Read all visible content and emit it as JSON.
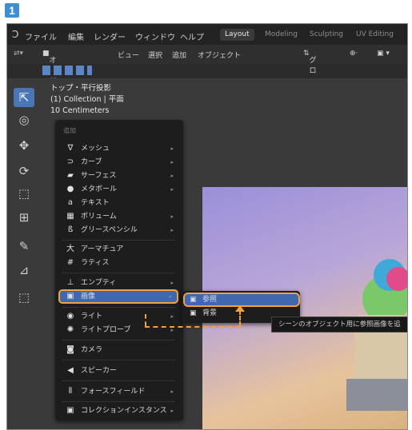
{
  "step_badge": "1",
  "topbar": {
    "logo": "Ɔ",
    "menus": [
      "ファイル",
      "編集",
      "レンダー",
      "ウィンドウ",
      "ヘルプ"
    ],
    "workspaces": [
      "Layout",
      "Modeling",
      "Sculpting",
      "UV Editing"
    ],
    "active_workspace": "Layout"
  },
  "header": {
    "mode": "オブジェクト...",
    "items": [
      "ビュー",
      "選択",
      "追加",
      "オブジェクト"
    ],
    "transform": "グロー...",
    "view_icons": "⊕·"
  },
  "viewport_info": {
    "line1": "トップ・平行投影",
    "line2": "(1) Collection | 平面",
    "line3": "10 Centimeters"
  },
  "add_menu": {
    "title": "追加",
    "items": [
      {
        "icon": "∇",
        "label": "メッシュ",
        "submenu": true
      },
      {
        "icon": "⊃",
        "label": "カーブ",
        "submenu": true
      },
      {
        "icon": "▰",
        "label": "サーフェス",
        "submenu": true
      },
      {
        "icon": "●",
        "label": "メタボール",
        "submenu": true
      },
      {
        "icon": "a",
        "label": "テキスト",
        "submenu": false
      },
      {
        "icon": "▦",
        "label": "ボリューム",
        "submenu": true
      },
      {
        "icon": "ß",
        "label": "グリースペンシル",
        "submenu": true
      },
      {
        "icon": "大",
        "label": "アーマチュア",
        "submenu": false
      },
      {
        "icon": "#",
        "label": "ラティス",
        "submenu": false
      },
      {
        "icon": "⊥",
        "label": "エンプティ",
        "submenu": true
      },
      {
        "icon": "▣",
        "label": "画像",
        "submenu": true
      },
      {
        "icon": "◉",
        "label": "ライト",
        "submenu": true
      },
      {
        "icon": "✺",
        "label": "ライトプローブ",
        "submenu": true
      },
      {
        "icon": "◙",
        "label": "カメラ",
        "submenu": false
      },
      {
        "icon": "◀",
        "label": "スピーカー",
        "submenu": false
      },
      {
        "icon": "⦀",
        "label": "フォースフィールド",
        "submenu": true
      },
      {
        "icon": "▣",
        "label": "コレクションインスタンス",
        "submenu": true
      }
    ]
  },
  "image_submenu": {
    "items": [
      {
        "icon": "▣",
        "label": "参照"
      },
      {
        "icon": "▣",
        "label": "背景"
      }
    ]
  },
  "tooltip": "シーンのオブジェクト用に参照画像を追",
  "colors": {
    "highlight": "#3f68b0",
    "callout": "#f0a23c",
    "badge": "#3f8fd0"
  }
}
